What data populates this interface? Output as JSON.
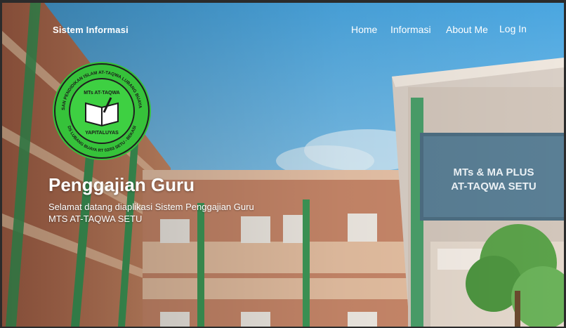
{
  "header": {
    "brand": "Sistem Informasi",
    "nav": {
      "home": "Home",
      "informasi": "Informasi",
      "about": "About Me",
      "login": "Log In"
    }
  },
  "logo": {
    "ring_text_top": "YAYASAN PENDIDIKAN ISLAM AT-TAQWA LUBANG BUAYA SETU",
    "ring_text_bottom": "DS LUBANG BUAYA RT 02/03 SETU - BEKASI",
    "inner_top": "MTs AT-TAQWA",
    "inner_bottom": "YAPITALUYAS",
    "colors": {
      "outer": "#36c23a",
      "ring": "#1f1f1f",
      "inner": "#3ed042"
    }
  },
  "background_sign": {
    "line1": "MTs & MA PLUS",
    "line2": "AT-TAQWA SETU"
  },
  "hero": {
    "title": "Penggajian Guru",
    "subtitle_line1": "Selamat datang diaplikasi Sistem Penggajian Guru",
    "subtitle_line2": "MTS AT-TAQWA SETU"
  }
}
